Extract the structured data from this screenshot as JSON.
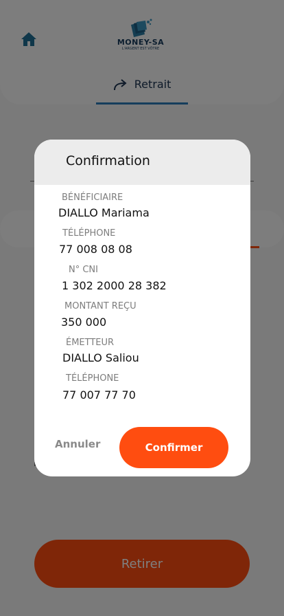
{
  "header": {
    "brand_name": "MONEY-SA",
    "brand_tagline": "L'ARGENT EST VÔTRE",
    "active_tab": "Retrait"
  },
  "main": {
    "submit_label": "Retirer"
  },
  "modal": {
    "title": "Confirmation",
    "fields": [
      {
        "label": "BÉNÉFICIAIRE",
        "value": "DIALLO Mariama"
      },
      {
        "label": "TÉLÉPHONE",
        "value": "77 008 08 08"
      },
      {
        "label": "N° CNI",
        "value": "1 302 2000 28 382"
      },
      {
        "label": "MONTANT REÇU",
        "value": "350 000"
      },
      {
        "label": "ÉMETTEUR",
        "value": "DIALLO Saliou"
      },
      {
        "label": "TÉLÉPHONE",
        "value": "77 007 77 70"
      }
    ],
    "cancel_label": "Annuler",
    "confirm_label": "Confirmer"
  },
  "colors": {
    "accent": "#ff4d10",
    "tab_indicator": "#2b7bb9",
    "brand_navy": "#163a5c"
  },
  "icons": {
    "home": "home-icon",
    "withdraw": "share-arrow-icon",
    "logo": "money-logo-icon"
  }
}
